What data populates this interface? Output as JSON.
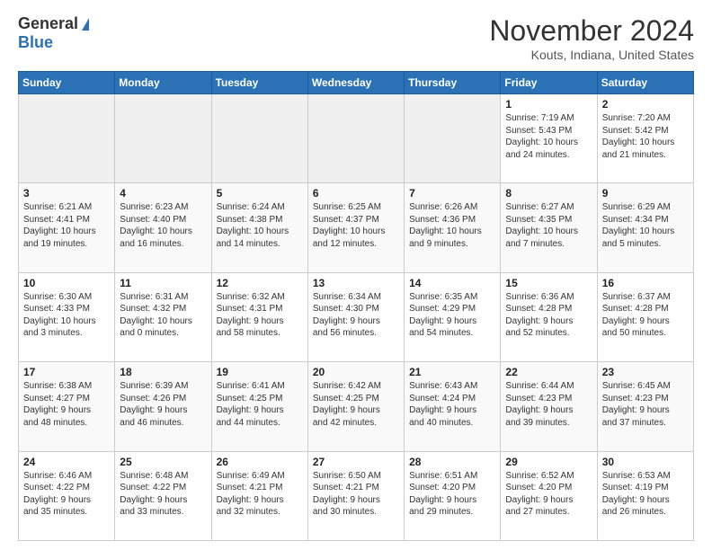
{
  "logo": {
    "general": "General",
    "blue": "Blue"
  },
  "title": "November 2024",
  "location": "Kouts, Indiana, United States",
  "weekdays": [
    "Sunday",
    "Monday",
    "Tuesday",
    "Wednesday",
    "Thursday",
    "Friday",
    "Saturday"
  ],
  "weeks": [
    [
      {
        "day": "",
        "info": ""
      },
      {
        "day": "",
        "info": ""
      },
      {
        "day": "",
        "info": ""
      },
      {
        "day": "",
        "info": ""
      },
      {
        "day": "",
        "info": ""
      },
      {
        "day": "1",
        "info": "Sunrise: 7:19 AM\nSunset: 5:43 PM\nDaylight: 10 hours\nand 24 minutes."
      },
      {
        "day": "2",
        "info": "Sunrise: 7:20 AM\nSunset: 5:42 PM\nDaylight: 10 hours\nand 21 minutes."
      }
    ],
    [
      {
        "day": "3",
        "info": "Sunrise: 6:21 AM\nSunset: 4:41 PM\nDaylight: 10 hours\nand 19 minutes."
      },
      {
        "day": "4",
        "info": "Sunrise: 6:23 AM\nSunset: 4:40 PM\nDaylight: 10 hours\nand 16 minutes."
      },
      {
        "day": "5",
        "info": "Sunrise: 6:24 AM\nSunset: 4:38 PM\nDaylight: 10 hours\nand 14 minutes."
      },
      {
        "day": "6",
        "info": "Sunrise: 6:25 AM\nSunset: 4:37 PM\nDaylight: 10 hours\nand 12 minutes."
      },
      {
        "day": "7",
        "info": "Sunrise: 6:26 AM\nSunset: 4:36 PM\nDaylight: 10 hours\nand 9 minutes."
      },
      {
        "day": "8",
        "info": "Sunrise: 6:27 AM\nSunset: 4:35 PM\nDaylight: 10 hours\nand 7 minutes."
      },
      {
        "day": "9",
        "info": "Sunrise: 6:29 AM\nSunset: 4:34 PM\nDaylight: 10 hours\nand 5 minutes."
      }
    ],
    [
      {
        "day": "10",
        "info": "Sunrise: 6:30 AM\nSunset: 4:33 PM\nDaylight: 10 hours\nand 3 minutes."
      },
      {
        "day": "11",
        "info": "Sunrise: 6:31 AM\nSunset: 4:32 PM\nDaylight: 10 hours\nand 0 minutes."
      },
      {
        "day": "12",
        "info": "Sunrise: 6:32 AM\nSunset: 4:31 PM\nDaylight: 9 hours\nand 58 minutes."
      },
      {
        "day": "13",
        "info": "Sunrise: 6:34 AM\nSunset: 4:30 PM\nDaylight: 9 hours\nand 56 minutes."
      },
      {
        "day": "14",
        "info": "Sunrise: 6:35 AM\nSunset: 4:29 PM\nDaylight: 9 hours\nand 54 minutes."
      },
      {
        "day": "15",
        "info": "Sunrise: 6:36 AM\nSunset: 4:28 PM\nDaylight: 9 hours\nand 52 minutes."
      },
      {
        "day": "16",
        "info": "Sunrise: 6:37 AM\nSunset: 4:28 PM\nDaylight: 9 hours\nand 50 minutes."
      }
    ],
    [
      {
        "day": "17",
        "info": "Sunrise: 6:38 AM\nSunset: 4:27 PM\nDaylight: 9 hours\nand 48 minutes."
      },
      {
        "day": "18",
        "info": "Sunrise: 6:39 AM\nSunset: 4:26 PM\nDaylight: 9 hours\nand 46 minutes."
      },
      {
        "day": "19",
        "info": "Sunrise: 6:41 AM\nSunset: 4:25 PM\nDaylight: 9 hours\nand 44 minutes."
      },
      {
        "day": "20",
        "info": "Sunrise: 6:42 AM\nSunset: 4:25 PM\nDaylight: 9 hours\nand 42 minutes."
      },
      {
        "day": "21",
        "info": "Sunrise: 6:43 AM\nSunset: 4:24 PM\nDaylight: 9 hours\nand 40 minutes."
      },
      {
        "day": "22",
        "info": "Sunrise: 6:44 AM\nSunset: 4:23 PM\nDaylight: 9 hours\nand 39 minutes."
      },
      {
        "day": "23",
        "info": "Sunrise: 6:45 AM\nSunset: 4:23 PM\nDaylight: 9 hours\nand 37 minutes."
      }
    ],
    [
      {
        "day": "24",
        "info": "Sunrise: 6:46 AM\nSunset: 4:22 PM\nDaylight: 9 hours\nand 35 minutes."
      },
      {
        "day": "25",
        "info": "Sunrise: 6:48 AM\nSunset: 4:22 PM\nDaylight: 9 hours\nand 33 minutes."
      },
      {
        "day": "26",
        "info": "Sunrise: 6:49 AM\nSunset: 4:21 PM\nDaylight: 9 hours\nand 32 minutes."
      },
      {
        "day": "27",
        "info": "Sunrise: 6:50 AM\nSunset: 4:21 PM\nDaylight: 9 hours\nand 30 minutes."
      },
      {
        "day": "28",
        "info": "Sunrise: 6:51 AM\nSunset: 4:20 PM\nDaylight: 9 hours\nand 29 minutes."
      },
      {
        "day": "29",
        "info": "Sunrise: 6:52 AM\nSunset: 4:20 PM\nDaylight: 9 hours\nand 27 minutes."
      },
      {
        "day": "30",
        "info": "Sunrise: 6:53 AM\nSunset: 4:19 PM\nDaylight: 9 hours\nand 26 minutes."
      }
    ]
  ]
}
